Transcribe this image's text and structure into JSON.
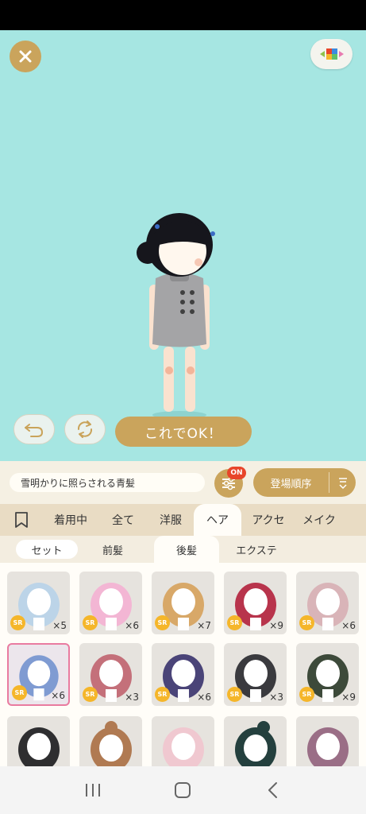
{
  "action_bar": {
    "ok_label": "これでOK！"
  },
  "search": {
    "value": "雪明かりに照らされる青髪"
  },
  "filter": {
    "badge": "ON"
  },
  "sort": {
    "label": "登場順序"
  },
  "category_tabs": [
    {
      "label": "着用中"
    },
    {
      "label": "全て"
    },
    {
      "label": "洋服"
    },
    {
      "label": "ヘア"
    },
    {
      "label": "アクセ"
    },
    {
      "label": "メイク"
    }
  ],
  "sub_tabs": [
    {
      "label": "セット"
    },
    {
      "label": "前髪"
    },
    {
      "label": "後髪"
    },
    {
      "label": "エクステ"
    }
  ],
  "items": [
    {
      "rarity": "SR",
      "count": "×5",
      "color": "#bcd4e8"
    },
    {
      "rarity": "SR",
      "count": "×6",
      "color": "#f3b6d4"
    },
    {
      "rarity": "SR",
      "count": "×7",
      "color": "#d8a868"
    },
    {
      "rarity": "SR",
      "count": "×9",
      "color": "#b8344c"
    },
    {
      "rarity": "SR",
      "count": "×6",
      "color": "#d9b4b8"
    },
    {
      "rarity": "SR",
      "count": "×6",
      "color": "#7f9bd2"
    },
    {
      "rarity": "SR",
      "count": "×3",
      "color": "#c4707a"
    },
    {
      "rarity": "SR",
      "count": "×6",
      "color": "#4a4478"
    },
    {
      "rarity": "SR",
      "count": "×3",
      "color": "#3a3a3e"
    },
    {
      "rarity": "SR",
      "count": "×9",
      "color": "#3d4a3a"
    },
    {
      "rarity": "",
      "count": "",
      "color": "#2e2e30"
    },
    {
      "rarity": "",
      "count": "",
      "color": "#b07a52"
    },
    {
      "rarity": "",
      "count": "",
      "color": "#f0c8d0"
    },
    {
      "rarity": "",
      "count": "",
      "color": "#24403e"
    },
    {
      "rarity": "",
      "count": "",
      "color": "#9a6e86"
    }
  ],
  "colors": {
    "stage_bg": "#a6e6e2",
    "accent_gold": "#caa45c",
    "badge_red": "#e8452a",
    "rarity_yellow": "#f5b62a",
    "selected_border": "#e97ba0"
  },
  "icons": {
    "close": "close-icon",
    "palette": "color-palette-icon",
    "undo": "undo-icon",
    "shuffle": "shuffle-icon",
    "filter": "filter-sliders-icon",
    "sort": "sort-order-icon",
    "bookmark": "bookmark-icon",
    "recent": "recent-apps-icon",
    "home": "home-icon",
    "back": "back-icon"
  }
}
